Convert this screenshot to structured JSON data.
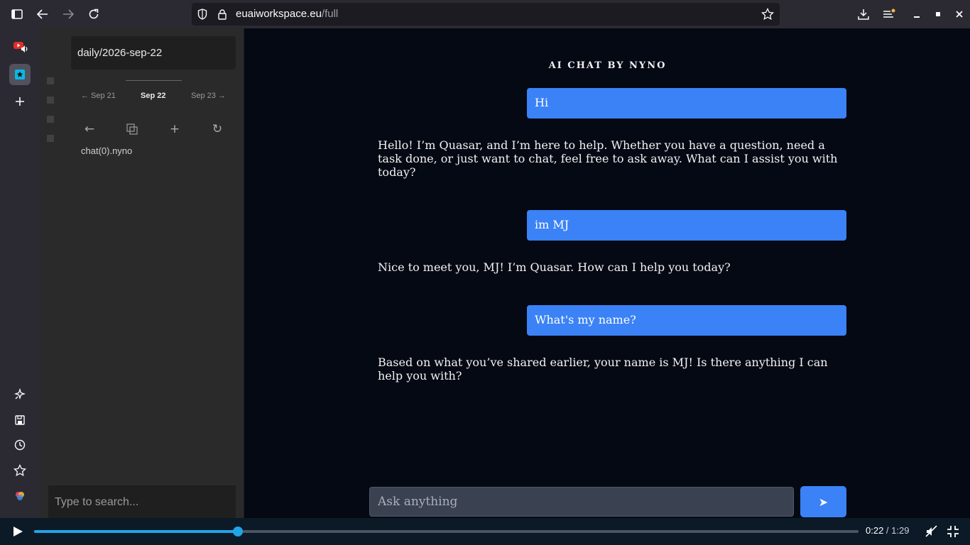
{
  "browser": {
    "url_host": "euaiworkspace.eu",
    "url_path": "/full"
  },
  "panel": {
    "path_value": "daily/2026-sep-22",
    "date_prev": "← Sep 21",
    "date_current": "Sep 22",
    "date_next": "Sep 23 →",
    "actions": {
      "back": "←",
      "add": "+",
      "refresh": "↻"
    },
    "files": [
      "chat(0).nyno"
    ],
    "search_placeholder": "Type to search..."
  },
  "chat": {
    "title": "AI CHAT BY NYNO",
    "messages": [
      {
        "role": "user",
        "text": "Hi"
      },
      {
        "role": "assistant",
        "text": "Hello! I’m Quasar, and I’m here to help. Whether you have a question, need a task done, or just want to chat, feel free to ask away. What can I assist you with today?"
      },
      {
        "role": "user",
        "text": "im MJ"
      },
      {
        "role": "assistant",
        "text": "Nice to meet you, MJ! I’m Quasar. How can I help you today?"
      },
      {
        "role": "user",
        "text": "What's my name?"
      },
      {
        "role": "assistant",
        "text": "Based on what you’ve shared earlier, your name is MJ! Is there anything I can help you with?"
      }
    ],
    "input_placeholder": "Ask anything",
    "send_label": "➤"
  },
  "video": {
    "current_time": "0:22",
    "separator": " / ",
    "total_time": "1:29",
    "progress_fraction": 0.247
  },
  "colors": {
    "accent": "#3b82f6",
    "chat_bg": "#050914",
    "progress": "#21a4e6"
  }
}
